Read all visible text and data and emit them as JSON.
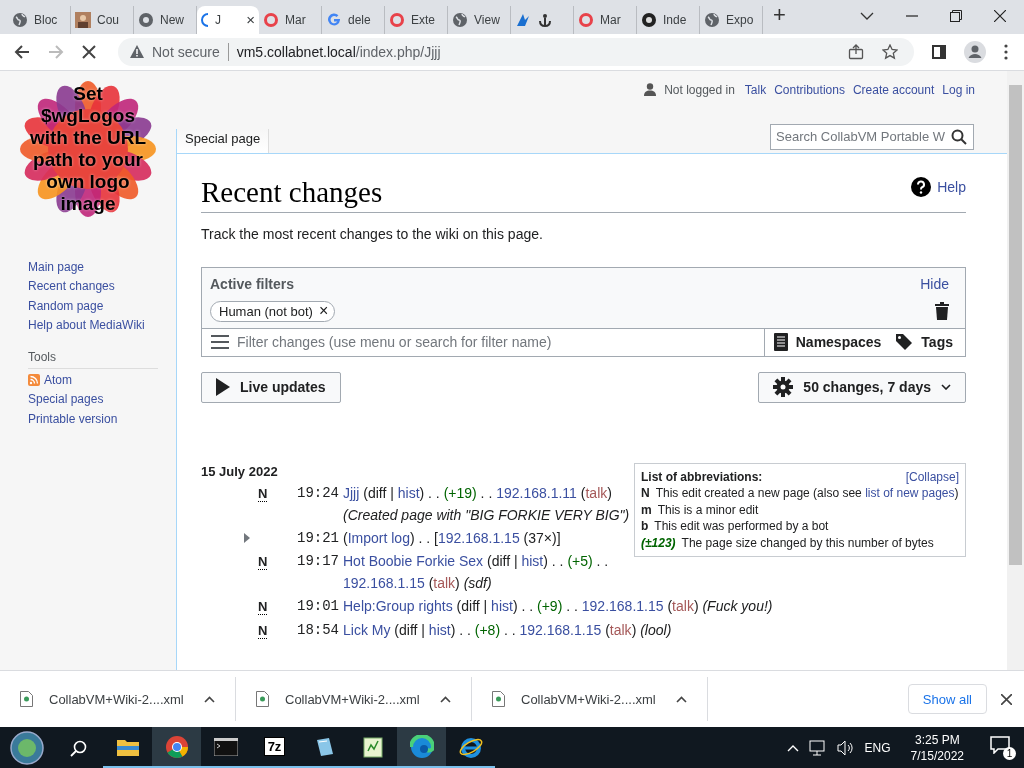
{
  "browser_tabs": [
    {
      "title": "Bloc",
      "selected": false
    },
    {
      "title": "Cou",
      "selected": false
    },
    {
      "title": "New",
      "selected": false
    },
    {
      "title": "J",
      "selected": true,
      "close": "×"
    },
    {
      "title": "Mar",
      "selected": false
    },
    {
      "title": "dele",
      "selected": false
    },
    {
      "title": "Exte",
      "selected": false
    },
    {
      "title": "View",
      "selected": false
    },
    {
      "selected": false
    },
    {
      "title": "Mar",
      "selected": false
    },
    {
      "title": "Inde",
      "selected": false
    },
    {
      "title": "Expo",
      "selected": false
    }
  ],
  "new_tab": "+",
  "address": {
    "security": "Not secure",
    "host": "vm5.collabnet.local",
    "path": "/index.php/Jjjj"
  },
  "logo_text": "Set $wgLogos with the URL path to your own logo image",
  "sidebar": {
    "navigation": [
      "Main page",
      "Recent changes",
      "Random page",
      "Help about MediaWiki"
    ],
    "tools_heading": "Tools",
    "tools": [
      {
        "kind": "feed",
        "label": "Atom"
      },
      {
        "kind": "plain",
        "label": "Special pages"
      },
      {
        "kind": "plain",
        "label": "Printable version"
      }
    ]
  },
  "personal": {
    "status": "Not logged in",
    "links": [
      "Talk",
      "Contributions",
      "Create account",
      "Log in"
    ]
  },
  "page_tab": "Special page",
  "search": {
    "placeholder": "Search CollabVM Portable W"
  },
  "title": "Recent changes",
  "help": "Help",
  "intro": "Track the most recent changes to the wiki on this page.",
  "filters": {
    "heading": "Active filters",
    "hide": "Hide",
    "chips": [
      {
        "label": "Human (not bot)",
        "remove": "×"
      }
    ],
    "placeholder": "Filter changes (use menu or search for filter name)",
    "namespaces": "Namespaces",
    "tags": "Tags"
  },
  "live_updates": "Live updates",
  "settings": "50 changes, 7 days",
  "abbreviations": {
    "title": "List of abbreviations:",
    "collapse": "[Collapse]",
    "rows": [
      {
        "key": "N",
        "kind": "plain",
        "parts": [
          {
            "kind": "text",
            "text": "This edit created a new page (also see "
          },
          {
            "kind": "link",
            "text": "list of new pages"
          },
          {
            "kind": "text",
            "text": ")"
          }
        ]
      },
      {
        "key": "m",
        "kind": "plain",
        "parts": [
          {
            "kind": "text",
            "text": "This is a minor edit"
          }
        ]
      },
      {
        "key": "b",
        "kind": "plain",
        "parts": [
          {
            "kind": "text",
            "text": "This edit was performed by a bot"
          }
        ]
      },
      {
        "key": "(±123)",
        "kind": "size",
        "parts": [
          {
            "kind": "text",
            "text": "The page size changed by this number of bytes"
          }
        ]
      }
    ]
  },
  "date": "15 July 2022",
  "changes": [
    {
      "flag": "N",
      "grouped": false,
      "time": "19:24",
      "parts": [
        {
          "kind": "link",
          "text": "Jjjj"
        },
        {
          "kind": "text",
          "text": " (diff | "
        },
        {
          "kind": "link",
          "text": "hist"
        },
        {
          "kind": "text",
          "text": ") . . "
        },
        {
          "kind": "size",
          "text": "(+19)"
        },
        {
          "kind": "text",
          "text": " . . "
        },
        {
          "kind": "link",
          "text": "192.168.1.11"
        },
        {
          "kind": "text",
          "text": " ("
        },
        {
          "kind": "talk",
          "text": "talk"
        },
        {
          "kind": "text",
          "text": ") "
        },
        {
          "kind": "comment",
          "text": "(Created page with \"BIG FORKIE VERY BIG\")"
        }
      ]
    },
    {
      "grouped": true,
      "time": "19:21",
      "parts": [
        {
          "kind": "text",
          "text": "("
        },
        {
          "kind": "link",
          "text": "Import log"
        },
        {
          "kind": "text",
          "text": ") . . ["
        },
        {
          "kind": "link",
          "text": "192.168.1.15"
        },
        {
          "kind": "text",
          "text": " (37×)]"
        }
      ]
    },
    {
      "flag": "N",
      "grouped": false,
      "time": "19:17",
      "parts": [
        {
          "kind": "link",
          "text": "Hot Boobie Forkie Sex"
        },
        {
          "kind": "text",
          "text": " (diff | "
        },
        {
          "kind": "link",
          "text": "hist"
        },
        {
          "kind": "text",
          "text": ") . . "
        },
        {
          "kind": "size",
          "text": "(+5)"
        },
        {
          "kind": "text",
          "text": " . . "
        },
        {
          "kind": "link",
          "text": "192.168.1.15"
        },
        {
          "kind": "text",
          "text": " ("
        },
        {
          "kind": "talk",
          "text": "talk"
        },
        {
          "kind": "text",
          "text": ") "
        },
        {
          "kind": "comment",
          "text": "(sdf)"
        }
      ]
    },
    {
      "flag": "N",
      "grouped": false,
      "time": "19:01",
      "parts": [
        {
          "kind": "link",
          "text": "Help:Group rights"
        },
        {
          "kind": "text",
          "text": " (diff | "
        },
        {
          "kind": "link",
          "text": "hist"
        },
        {
          "kind": "text",
          "text": ") . . "
        },
        {
          "kind": "size",
          "text": "(+9)"
        },
        {
          "kind": "text",
          "text": " . . "
        },
        {
          "kind": "link",
          "text": "192.168.1.15"
        },
        {
          "kind": "text",
          "text": " ("
        },
        {
          "kind": "talk",
          "text": "talk"
        },
        {
          "kind": "text",
          "text": ") "
        },
        {
          "kind": "comment",
          "text": "(Fuck you!)"
        }
      ]
    },
    {
      "flag": "N",
      "grouped": false,
      "time": "18:54",
      "parts": [
        {
          "kind": "link",
          "text": "Lick My"
        },
        {
          "kind": "text",
          "text": " (diff | "
        },
        {
          "kind": "link",
          "text": "hist"
        },
        {
          "kind": "text",
          "text": ") . . "
        },
        {
          "kind": "size",
          "text": "(+8)"
        },
        {
          "kind": "text",
          "text": " . . "
        },
        {
          "kind": "link",
          "text": "192.168.1.15"
        },
        {
          "kind": "text",
          "text": " ("
        },
        {
          "kind": "talk",
          "text": "talk"
        },
        {
          "kind": "text",
          "text": ") "
        },
        {
          "kind": "comment",
          "text": "(lool)"
        }
      ]
    }
  ],
  "downloads": {
    "items": [
      "CollabVM+Wiki-2....xml",
      "CollabVM+Wiki-2....xml",
      "CollabVM+Wiki-2....xml"
    ],
    "show_all": "Show all"
  },
  "taskbar": {
    "apps": [
      {
        "kind": "search",
        "active": false,
        "running": false
      },
      {
        "kind": "folder",
        "active": false,
        "running": true
      },
      {
        "kind": "chrome",
        "active": true,
        "running": true
      },
      {
        "kind": "terminal",
        "active": false,
        "running": true
      },
      {
        "kind": "archiver",
        "label": "7z",
        "active": false,
        "running": true
      },
      {
        "kind": "notepad",
        "active": false,
        "running": true
      },
      {
        "kind": "editor",
        "active": false,
        "running": true
      },
      {
        "kind": "edge",
        "active": true,
        "running": true
      },
      {
        "kind": "ie",
        "active": false,
        "running": true
      }
    ],
    "language": "ENG",
    "time": "3:25 PM",
    "date": "7/15/2022",
    "notifications": "1"
  }
}
